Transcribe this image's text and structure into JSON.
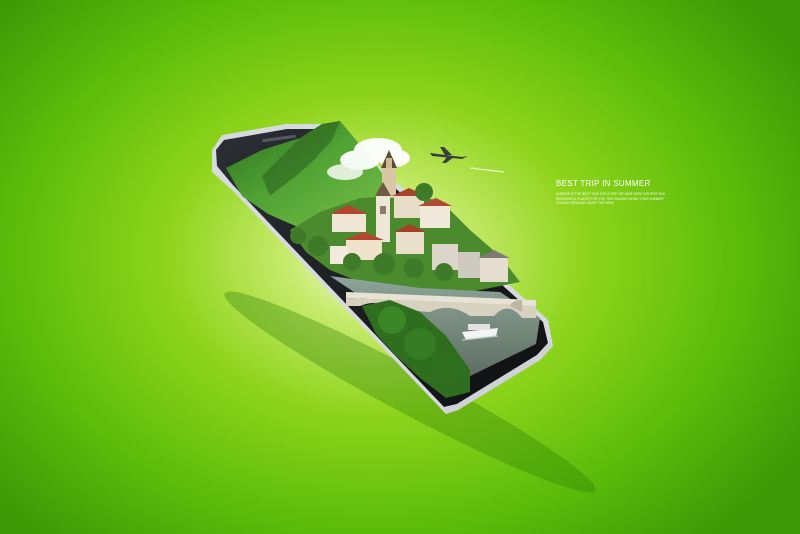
{
  "promo": {
    "title": "BEST TRIP IN SUMMER",
    "body": "Summer is the best time for a trip. We have new content and wonderful places for you this season. Book your summer holiday now and enjoy the view."
  },
  "colors": {
    "background_center": "#f4fbe4",
    "background_edge": "#3e9a06",
    "phone_body": "#1e2124",
    "phone_frame": "#d9dcdf",
    "mountain_green": "#3f8f2a",
    "roof_red": "#b5462e",
    "river": "#7c8d7a"
  }
}
